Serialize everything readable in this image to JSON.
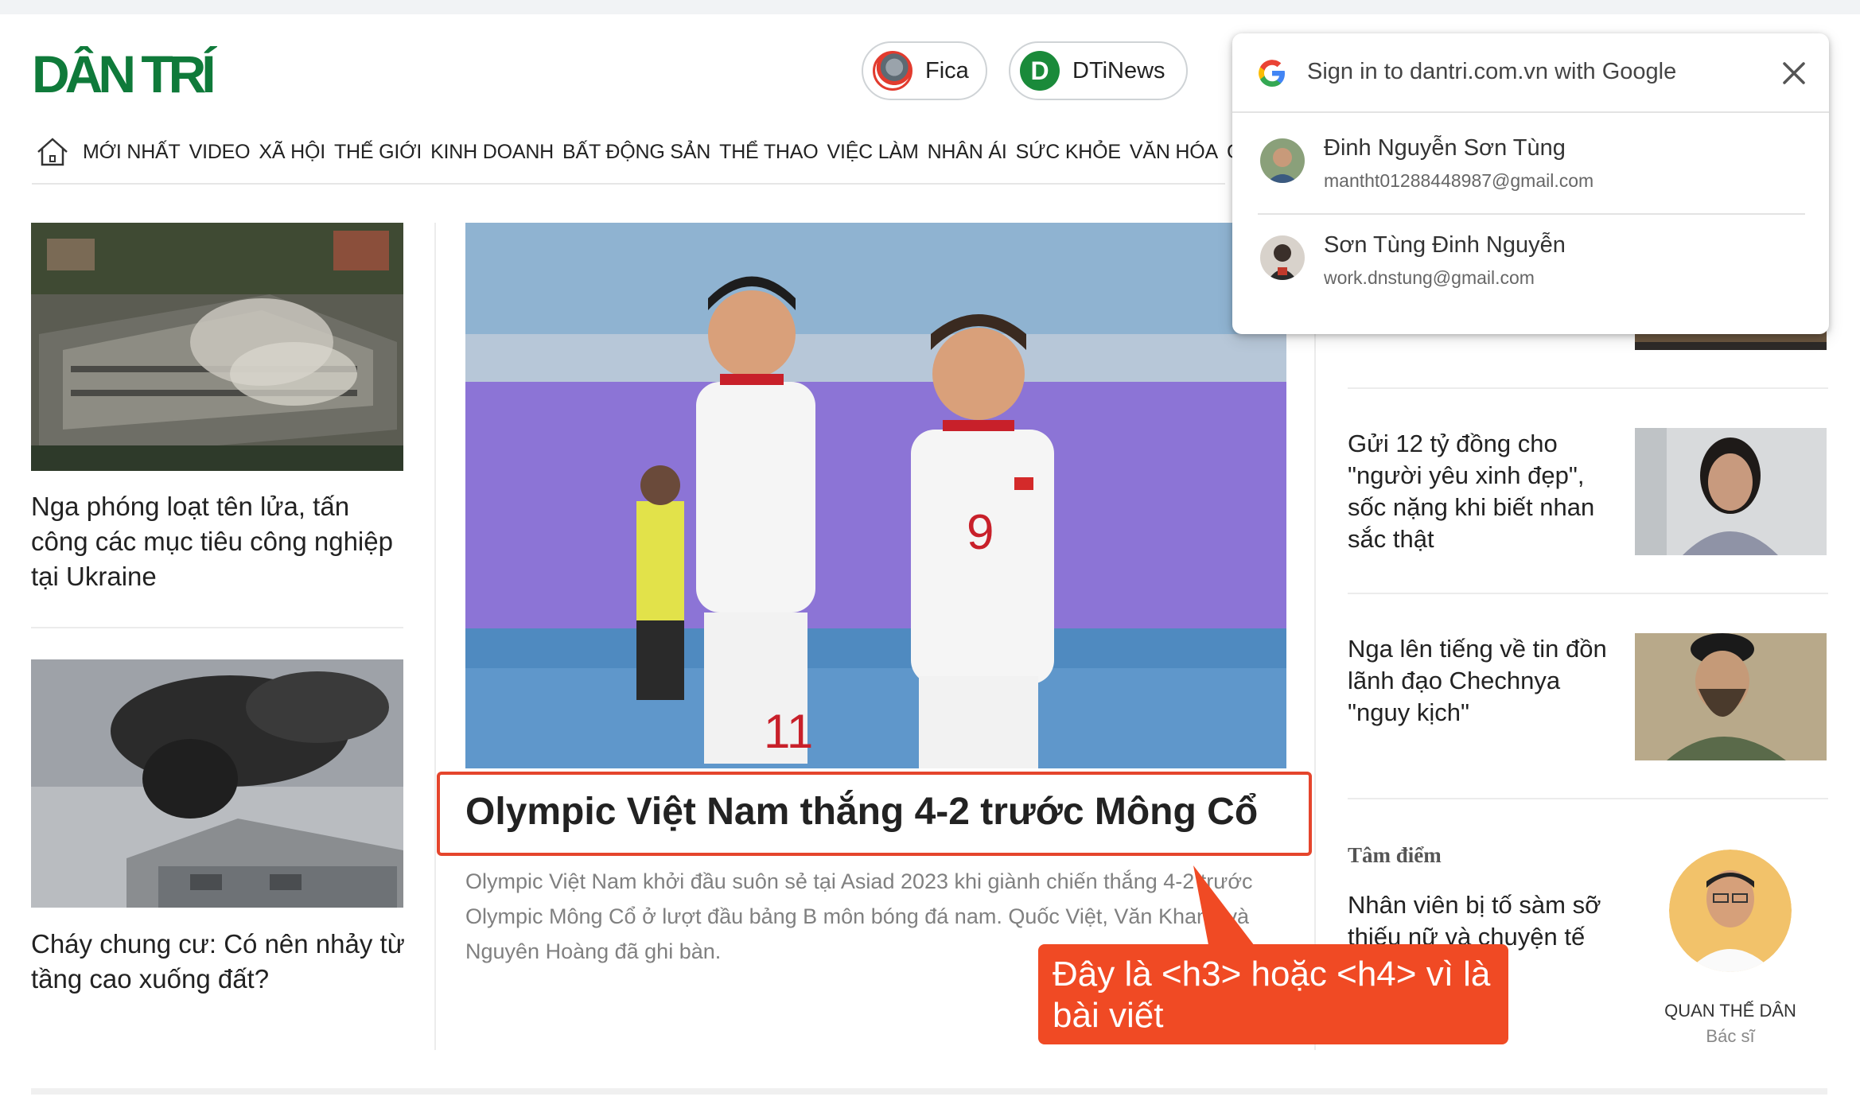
{
  "header": {
    "logo_text": "DÂN TRÍ",
    "fica_label": "Fica",
    "dtinews_label": "DTiNews",
    "dtinews_icon_letter": "D"
  },
  "nav": {
    "items": [
      "MỚI NHẤT",
      "VIDEO",
      "XÃ HỘI",
      "THẾ GIỚI",
      "KINH DOANH",
      "BẤT ĐỘNG SẢN",
      "THỂ THAO",
      "VIỆC LÀM",
      "NHÂN ÁI",
      "SỨC KHỎE",
      "VĂN HÓA",
      "GIẢI"
    ]
  },
  "left_column": {
    "articles": [
      {
        "title": "Nga phóng loạt tên lửa, tấn công các mục tiêu công nghiệp tại Ukraine"
      },
      {
        "title": "Cháy chung cư: Có nên nhảy từ tầng cao xuống đất?"
      }
    ]
  },
  "main_story": {
    "headline": "Olympic Việt Nam thắng 4-2 trước Mông Cổ",
    "sapo": "Olympic Việt Nam khởi đầu suôn sẻ tại Asiad 2023 khi giành chiến thắng 4-2 trước Olympic Mông Cổ ở lượt đầu bảng B môn bóng đá nam. Quốc Việt, Văn Khang và Nguyên Hoàng đã ghi bàn.",
    "jersey_numbers": [
      "11",
      "9"
    ]
  },
  "callout": {
    "text": "Đây là <h3> hoặc <h4> vì là bài viết"
  },
  "right_column": {
    "articles": [
      {
        "title": "Gửi 12 tỷ đồng cho \"người yêu xinh đẹp\", sốc nặng khi biết nhan sắc thật"
      },
      {
        "title": "Nga lên tiếng về tin đồn lãnh đạo Chechnya \"nguy kịch\""
      }
    ],
    "focus": {
      "label": "Tâm điểm",
      "title": "Nhân viên bị tố sàm sỡ thiếu nữ và chuyện tế",
      "author_name": "QUAN THẾ DÂN",
      "author_role": "Bác sĩ"
    }
  },
  "google_popup": {
    "title": "Sign in to dantri.com.vn with Google",
    "accounts": [
      {
        "name": "Đinh Nguyễn Sơn Tùng",
        "email": "mantht01288448987@gmail.com"
      },
      {
        "name": "Sơn Tùng Đinh Nguyễn",
        "email": "work.dnstung@gmail.com"
      }
    ]
  },
  "colors": {
    "brand_green": "#0f7a3a",
    "callout_red": "#f04a24",
    "highlight_border": "#e5452c"
  }
}
